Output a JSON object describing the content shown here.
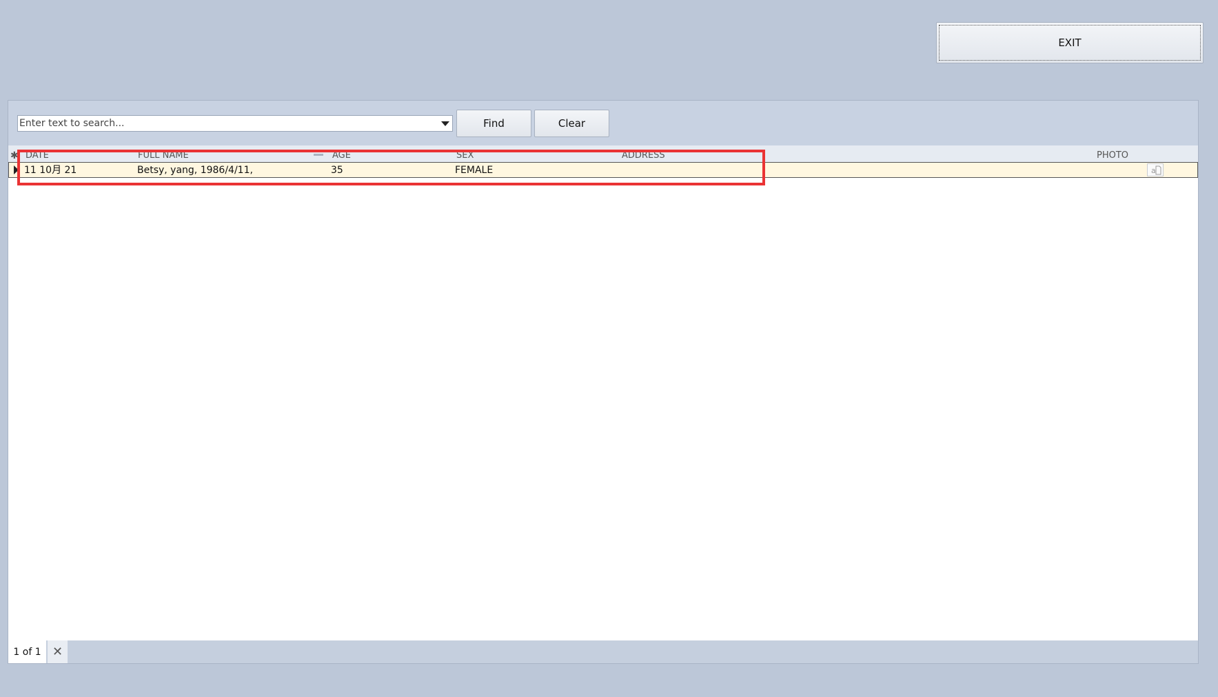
{
  "toolbar": {
    "exit_label": "EXIT"
  },
  "search": {
    "placeholder": "Enter text to search...",
    "find_label": "Find",
    "clear_label": "Clear"
  },
  "grid": {
    "columns": [
      "DATE",
      "FULL NAME",
      "AGE",
      "SEX",
      "ADDRESS",
      "PHOTO"
    ],
    "rows": [
      {
        "date": "11 10月 21",
        "full_name": "Betsy, yang, 1986/4/11,",
        "age": "35",
        "sex": "FEMALE",
        "address": "",
        "photo": "photo-placeholder-icon"
      }
    ]
  },
  "footer": {
    "page_info": "1 of 1",
    "close_icon": "close-x-icon"
  },
  "colors": {
    "background": "#bcc7d8",
    "selected_row": "#fff7e0",
    "highlight_border": "#ea3334"
  }
}
